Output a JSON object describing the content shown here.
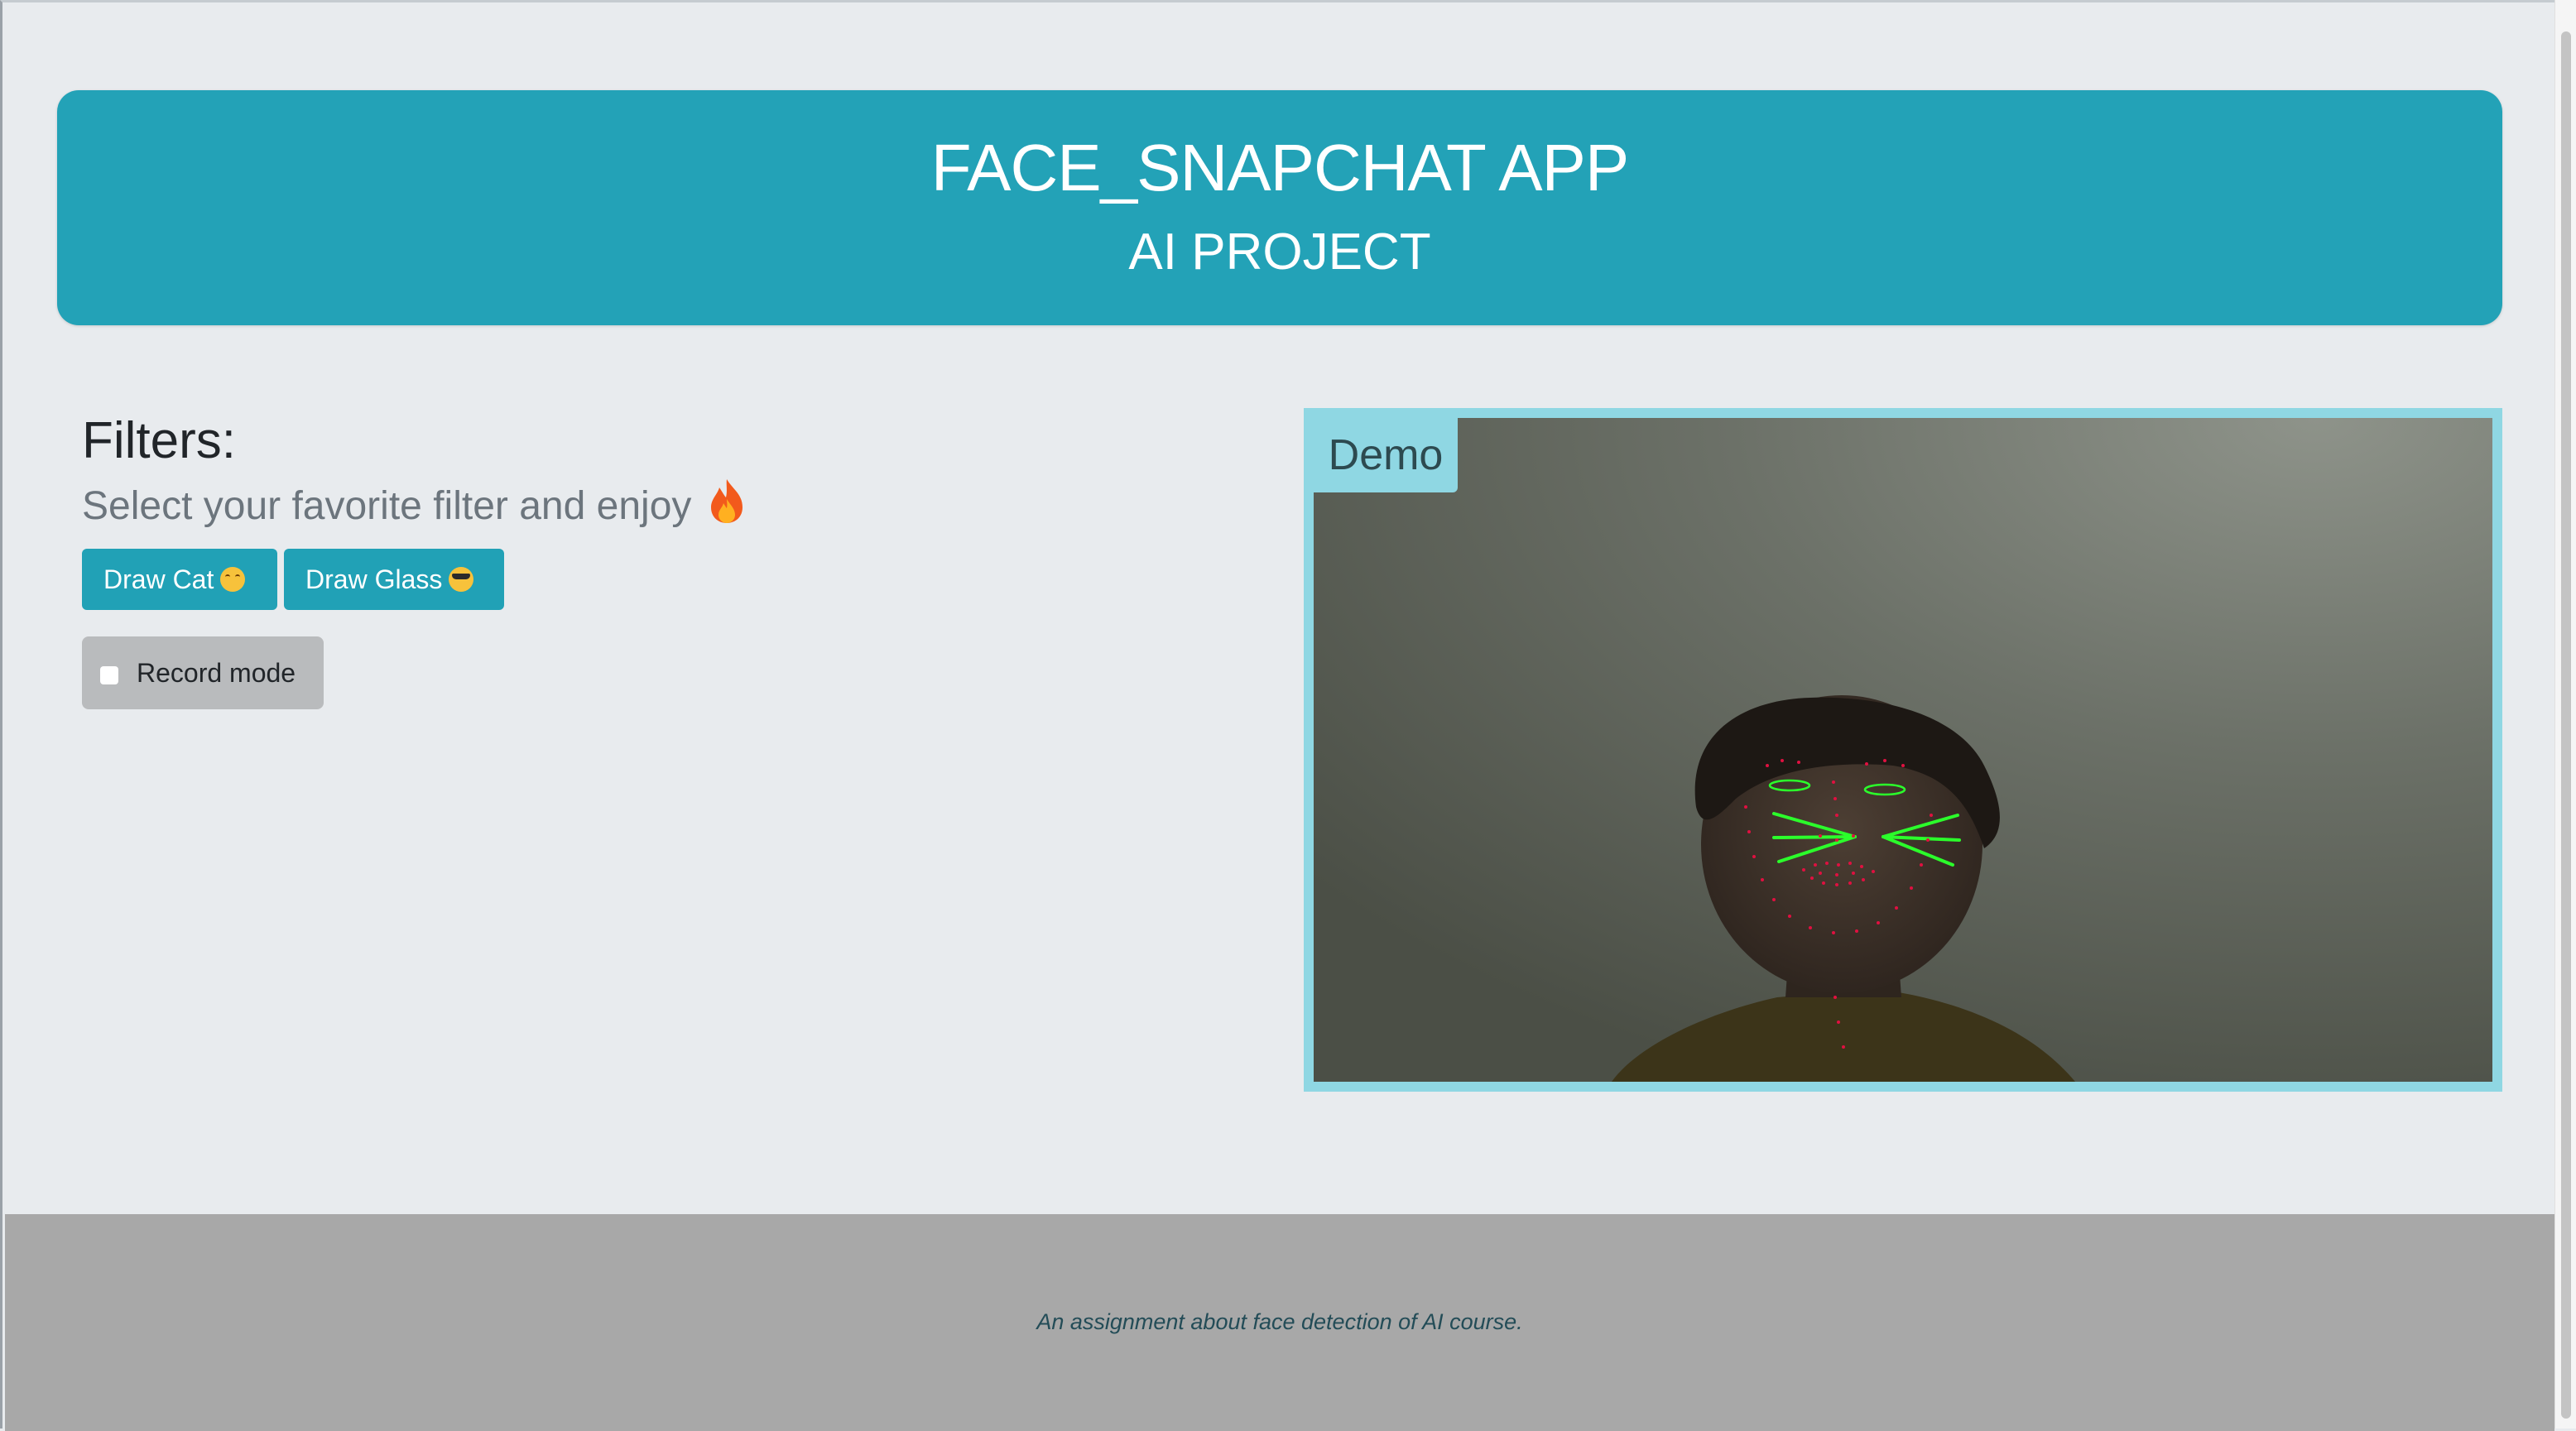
{
  "header": {
    "title": "FACE_SNAPCHAT APP",
    "subtitle": "AI PROJECT"
  },
  "filters": {
    "heading": "Filters:",
    "description": "Select your favorite filter and enjoy",
    "description_emoji": "fire-icon",
    "buttons": [
      {
        "label": "Draw Cat",
        "emoji": "cat-face-emoji-icon"
      },
      {
        "label": "Draw Glass",
        "emoji": "sunglasses-face-emoji-icon"
      }
    ],
    "record_mode": {
      "label": "Record mode",
      "checked": false
    }
  },
  "demo": {
    "label": "Demo"
  },
  "footer": {
    "text": "An assignment about face detection of AI course."
  },
  "colors": {
    "accent": "#23a2b7",
    "demo_frame": "#8fd7e3",
    "footer_bg": "#a8a8a8",
    "landmark_lines": "#2bff2b",
    "landmark_points": "#e01040"
  }
}
